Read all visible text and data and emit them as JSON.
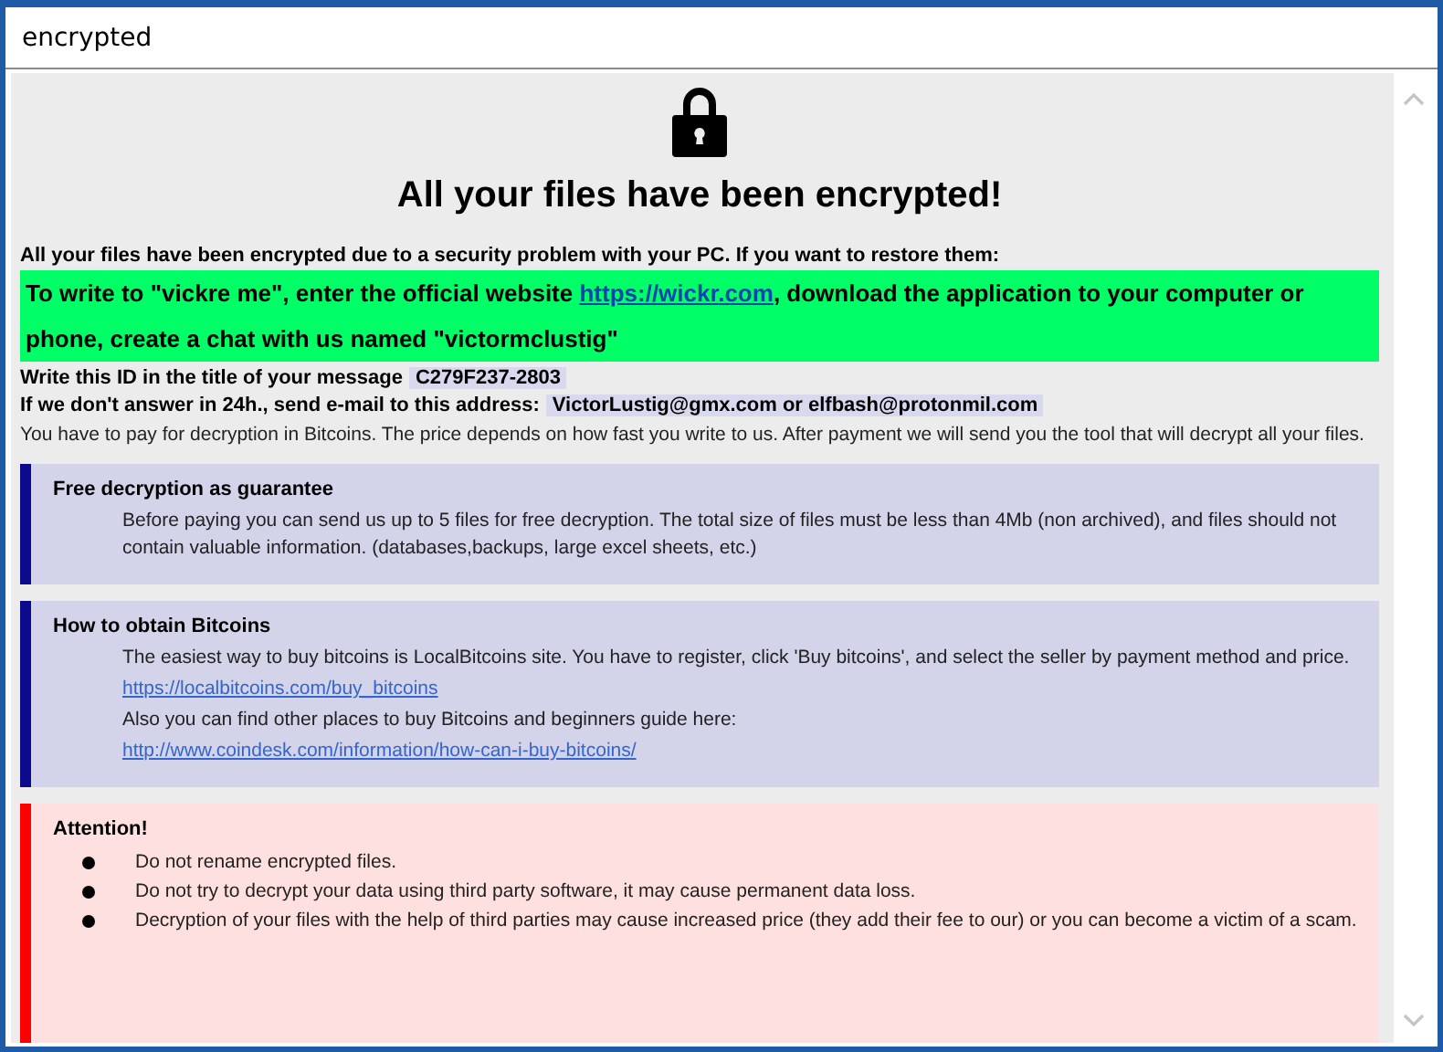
{
  "window": {
    "title": "encrypted"
  },
  "heading": "All your files have been encrypted!",
  "intro": "All your files have been encrypted due to a security problem with your PC. If you want to restore them:",
  "contact": {
    "before": "To write to \"vickre me\", enter the official website ",
    "link": "https://wickr.com",
    "after": ", download the application to your computer or phone, create a chat with us named \"victormclustig\""
  },
  "id_line": {
    "label": "Write this ID in the title of your message",
    "value": "C279F237-2803"
  },
  "email_line": {
    "label": "If we don't answer in 24h., send e-mail to this address:",
    "value": "VictorLustig@gmx.com or elfbash@protonmil.com"
  },
  "payment_note": "You have to pay for decryption in Bitcoins. The price depends on how fast you write to us. After payment we will send you the tool that will decrypt all your files.",
  "sections": [
    {
      "kind": "info",
      "title": "Free decryption as guarantee",
      "lines": [
        {
          "kind": "text",
          "text": "Before paying you can send us up to 5 files for free decryption. The total size of files must be less than 4Mb (non archived), and files should not contain valuable information. (databases,backups, large excel sheets, etc.)"
        }
      ]
    },
    {
      "kind": "info",
      "title": "How to obtain Bitcoins",
      "lines": [
        {
          "kind": "text",
          "text": "The easiest way to buy bitcoins is LocalBitcoins site. You have to register, click 'Buy bitcoins', and select the seller by payment method and price."
        },
        {
          "kind": "link",
          "text": "https://localbitcoins.com/buy_bitcoins"
        },
        {
          "kind": "text",
          "text": "Also you can find other places to buy Bitcoins and beginners guide here:"
        },
        {
          "kind": "link",
          "text": "http://www.coindesk.com/information/how-can-i-buy-bitcoins/"
        }
      ]
    },
    {
      "kind": "warning",
      "title": "Attention!",
      "lines": [
        {
          "kind": "bullet",
          "text": "Do not rename encrypted files."
        },
        {
          "kind": "bullet",
          "text": "Do not try to decrypt your data using third party software, it may cause permanent data loss."
        },
        {
          "kind": "bullet",
          "text": "Decryption of your files with the help of third parties may cause increased price (they add their fee to our) or you can become a victim of a scam."
        }
      ]
    }
  ]
}
